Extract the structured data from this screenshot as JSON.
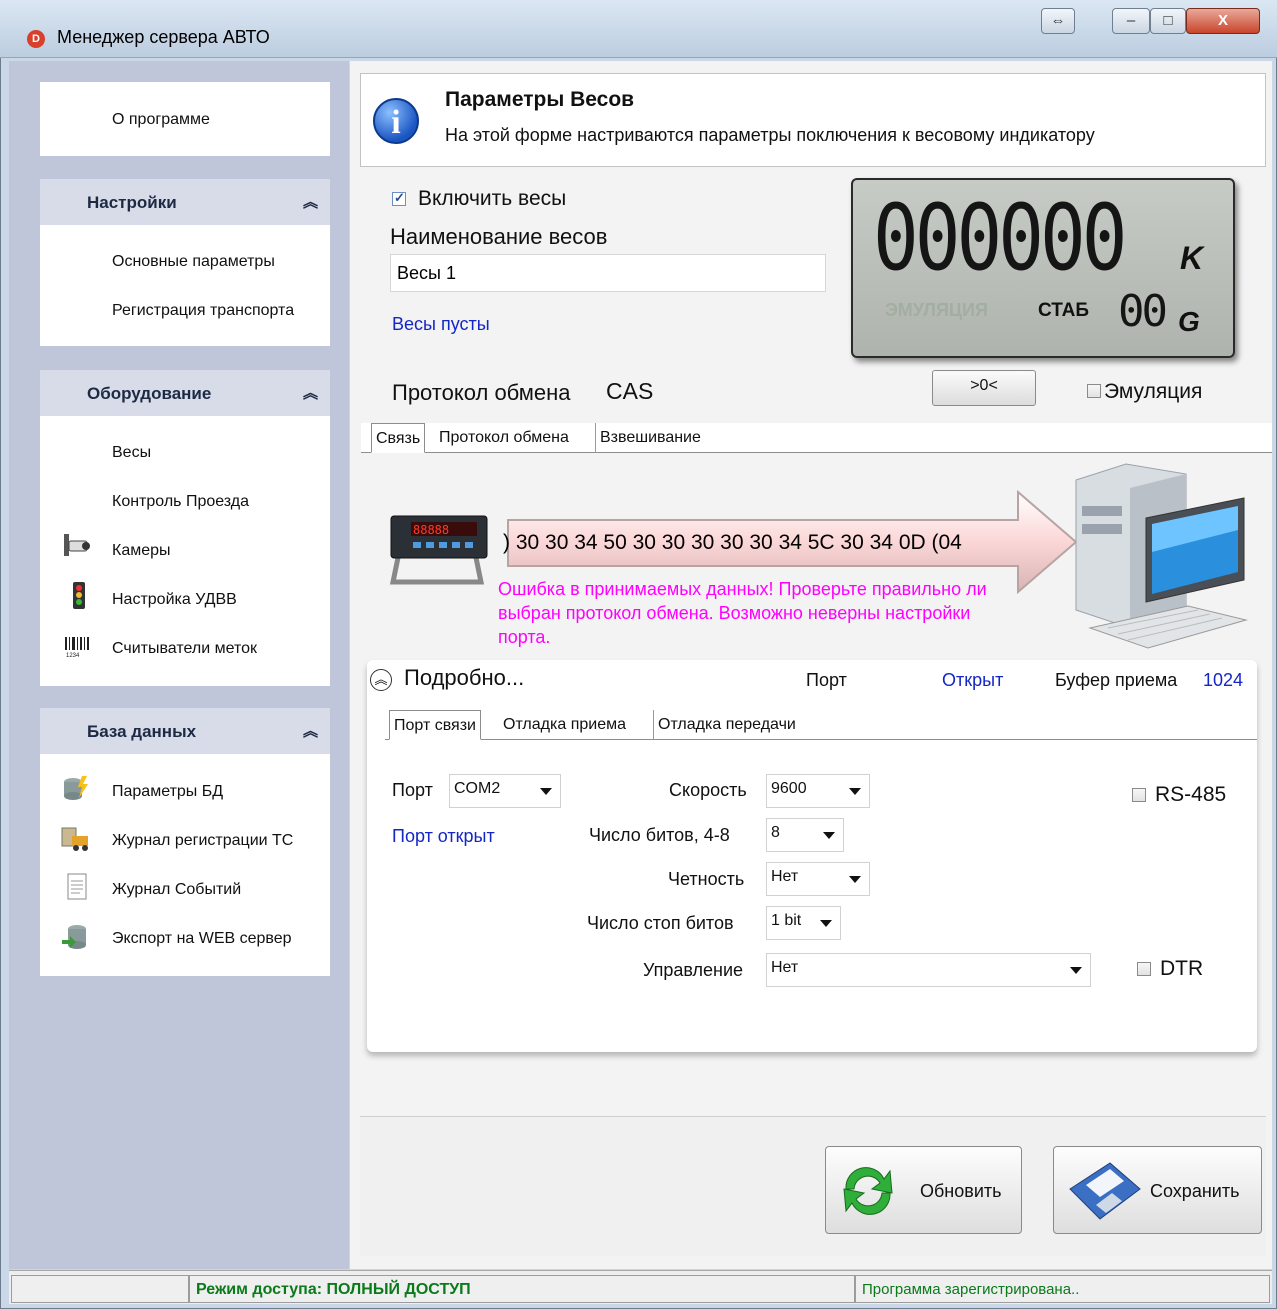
{
  "window": {
    "title": "Менеджер сервера АВТО",
    "app_icon_letter": "D",
    "controls": [
      "⇔",
      "–",
      "□",
      "X"
    ]
  },
  "sidebar": {
    "about": "О программе",
    "sections": [
      {
        "title": "Настройки",
        "items": [
          "Основные параметры",
          "Регистрация транспорта"
        ]
      },
      {
        "title": "Оборудование",
        "items": [
          "Весы",
          "Контроль Проезда",
          "Камеры",
          "Настройка УДВВ",
          "Считыватели меток"
        ]
      },
      {
        "title": "База данных",
        "items": [
          "Параметры БД",
          "Журнал регистрации ТС",
          "Журнал Событий",
          "Экспорт на WEB сервер"
        ]
      }
    ],
    "collapse_glyph": "⌃"
  },
  "header": {
    "title": "Параметры Весов",
    "description": "На этой форме настриваются параметры поключения к весовому индикатору"
  },
  "scale": {
    "enable_label": "Включить весы",
    "enabled": true,
    "name_label": "Наименование весов",
    "name_value": "Весы 1",
    "status": "Весы пусты",
    "protocol_label": "Протокол обмена",
    "protocol_value": "CAS"
  },
  "display": {
    "digits": "000000",
    "unit_top": "K",
    "emulation": "ЭМУЛЯЦИЯ",
    "stab": "СТАБ",
    "small_digits": "00",
    "unit_bottom": "G"
  },
  "zero_button": ">0<",
  "emulation_checkbox": {
    "label": "Эмуляция",
    "checked": false
  },
  "tabs": [
    "Связь",
    "Протокол обмена",
    "Взвешивание"
  ],
  "connection": {
    "hex_data": ") 30 30 34 50 30 30 30 30 30 34 5C 30 34 0D (04",
    "error": "Ошибка в принимаемых данных! Проверьте правильно ли выбран протокол обмена. Возможно неверны настройки порта.",
    "details_label": "Подробно...",
    "port_label": "Порт",
    "port_status": "Открыт",
    "buffer_label": "Буфер приема",
    "buffer_value": "1024"
  },
  "subtabs": [
    "Порт связи",
    "Отладка приема",
    "Отладка передачи"
  ],
  "port_settings": {
    "port_label": "Порт",
    "port_value": "COM2",
    "port_status": "Порт открыт",
    "speed_label": "Скорость",
    "speed_value": "9600",
    "bits_label": "Число битов, 4-8",
    "bits_value": "8",
    "parity_label": "Четность",
    "parity_value": "Нет",
    "stop_label": "Число стоп битов",
    "stop_value": "1 bit",
    "control_label": "Управление",
    "control_value": "Нет",
    "rs485_label": "RS-485",
    "rs485_checked": false,
    "dtr_label": "DTR",
    "dtr_checked": false
  },
  "actions": {
    "refresh": "Обновить",
    "save": "Сохранить"
  },
  "statusbar": {
    "access": "Режим доступа: ПОЛНЫЙ ДОСТУП",
    "registration": "Программа зарегистрирована.."
  },
  "colors": {
    "error": "#ff00ff",
    "link": "#1426c6",
    "access": "#0a7a1a",
    "sidebar_bg": "#c0c6d9"
  }
}
